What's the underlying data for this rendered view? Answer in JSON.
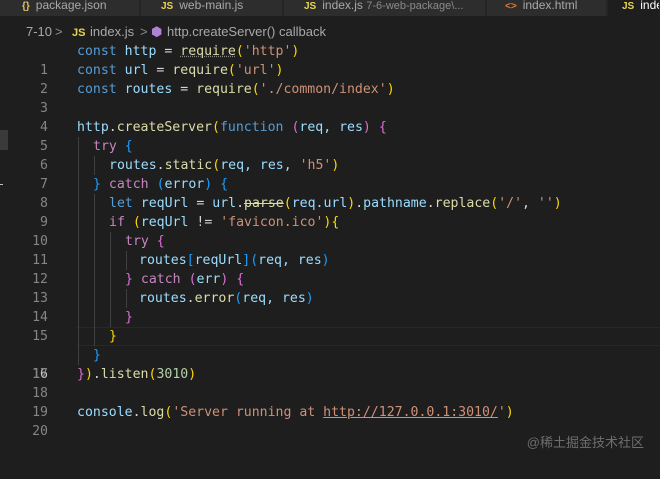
{
  "tabs": [
    {
      "icon": "{}",
      "label": "package.json",
      "desc": ""
    },
    {
      "icon": "JS",
      "label": "web-main.js",
      "desc": ""
    },
    {
      "icon": "JS",
      "label": "index.js",
      "desc": "7-6-web-package\\..."
    },
    {
      "icon": "<>",
      "label": "index.html",
      "desc": ""
    },
    {
      "icon": "JS",
      "label": "inde",
      "desc": ""
    }
  ],
  "breadcrumb": {
    "folder": "7-10",
    "sep": ">",
    "file_icon": "JS",
    "file": "index.js",
    "symbol": "http.createServer() callback"
  },
  "line_numbers": [
    "1",
    "2",
    "3",
    "4",
    "5",
    "6",
    "7",
    "8",
    "9",
    "10",
    "11",
    "12",
    "13",
    "14",
    "15",
    "16",
    "17",
    "18",
    "19",
    "20"
  ],
  "code": {
    "l1": {
      "kw": "const",
      "name": "http",
      "eq": " = ",
      "fn": "require",
      "arg": "'http'"
    },
    "l2": {
      "kw": "const",
      "name": "url",
      "eq": " = ",
      "fn": "require",
      "arg": "'url'"
    },
    "l3": {
      "kw": "const",
      "name": "routes",
      "eq": " = ",
      "fn": "require",
      "arg": "'./common/index'"
    },
    "l5": {
      "obj": "http",
      "fn": "createServer",
      "kw": "function",
      "params": "req, res"
    },
    "l6": {
      "kw": "try"
    },
    "l7": {
      "obj": "routes",
      "fn": "static",
      "args": "req, res, ",
      "str": "'h5'"
    },
    "l8": {
      "kw": "catch",
      "param": "error"
    },
    "l9": {
      "kw": "let",
      "name": "reqUrl",
      "eq": " = ",
      "obj": "url",
      "fn": "parse",
      "arg": "req.url",
      "prop": "pathname",
      "fn2": "replace",
      "s1": "'/'",
      "s2": "''"
    },
    "l10": {
      "kw": "if",
      "name": "reqUrl",
      "op": " != ",
      "str": "'favicon.ico'"
    },
    "l11": {
      "kw": "try"
    },
    "l12": {
      "obj": "routes",
      "key": "reqUrl",
      "args": "req, res"
    },
    "l13": {
      "kw": "catch",
      "param": "err"
    },
    "l14": {
      "obj": "routes",
      "fn": "error",
      "args": "req, res"
    },
    "l18": {
      "fn": "listen",
      "num": "3010"
    },
    "l20": {
      "obj": "console",
      "fn": "log",
      "str1": "'Server running at ",
      "url": "http://127.0.0.1:3010/",
      "str2": "'"
    }
  },
  "watermark": "@稀土掘金技术社区",
  "colors": {
    "background": "#1e1e1e",
    "keyword": "#569cd6",
    "control": "#c586c0",
    "variable": "#9cdcfe",
    "function": "#dcdcaa",
    "string": "#ce9178",
    "number": "#b5cea8"
  }
}
